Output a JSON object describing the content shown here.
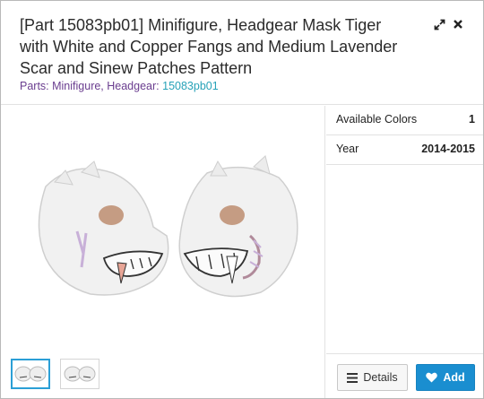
{
  "header": {
    "title": "[Part 15083pb01] Minifigure, Headgear Mask Tiger with White and Copper Fangs and Medium Lavender Scar and Sinew Patches Pattern",
    "breadcrumb_prefix": "Parts: Minifigure, Headgear:",
    "breadcrumb_link": "15083pb01",
    "icons": [
      "expand-icon",
      "close-icon"
    ]
  },
  "info": {
    "rows": [
      {
        "label": "Available Colors",
        "value": "1"
      },
      {
        "label": "Year",
        "value": "2014-2015"
      }
    ]
  },
  "footer": {
    "details_label": "Details",
    "add_label": "Add"
  },
  "colors": {
    "accent": "#1a8ed0",
    "breadcrumb": "#6a3d8f",
    "link": "#27a2b8"
  }
}
